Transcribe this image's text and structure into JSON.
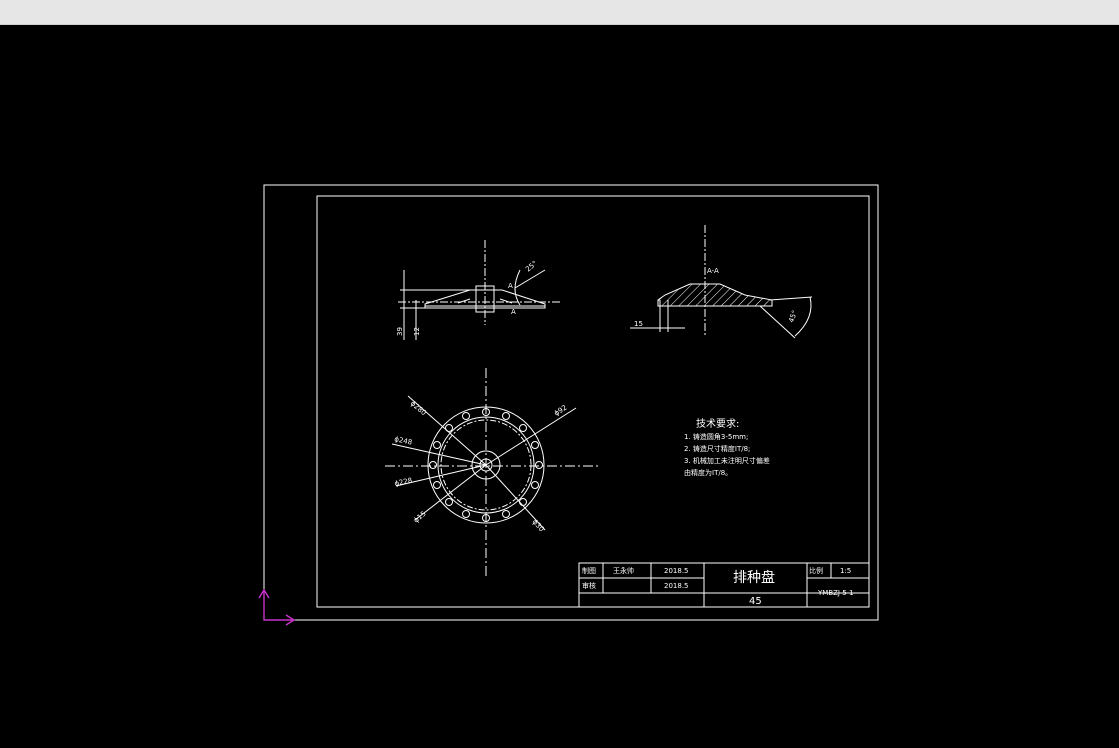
{
  "colors": {
    "background": "#000000",
    "line": "#ffffff",
    "ucs": "#cc33cc",
    "topbar": "#e6e6e6"
  },
  "views": {
    "side": {
      "dim_25": "25°",
      "dim_39": "39",
      "dim_12": "12",
      "label_a_top": "A",
      "label_a_bottom": "A"
    },
    "section": {
      "title": "A-A",
      "dim_15": "15",
      "dim_45": "45°"
    },
    "plan": {
      "d_280": "ϕ280",
      "d_248": "ϕ248",
      "d_228": "ϕ228",
      "d_15": "ϕ15",
      "d_92": "ϕ92",
      "d_30": "ϕ30"
    }
  },
  "notes": {
    "title": "技术要求:",
    "items": [
      "1. 铸造圆角3-5mm;",
      "2. 铸造尺寸精度IT/8;",
      "3. 机械加工未注明尺寸偏差",
      "   由精度为IT/8。"
    ]
  },
  "title_block": {
    "row1_label": "制图",
    "row1_name": "王永帅",
    "row1_date": "2018.5",
    "row2_label": "审核",
    "row2_date": "2018.5",
    "part_name": "排种盘",
    "material": "45",
    "scale_label": "比例",
    "scale_value": "1:5",
    "drawing_no": "YMBZJ 5-1"
  }
}
